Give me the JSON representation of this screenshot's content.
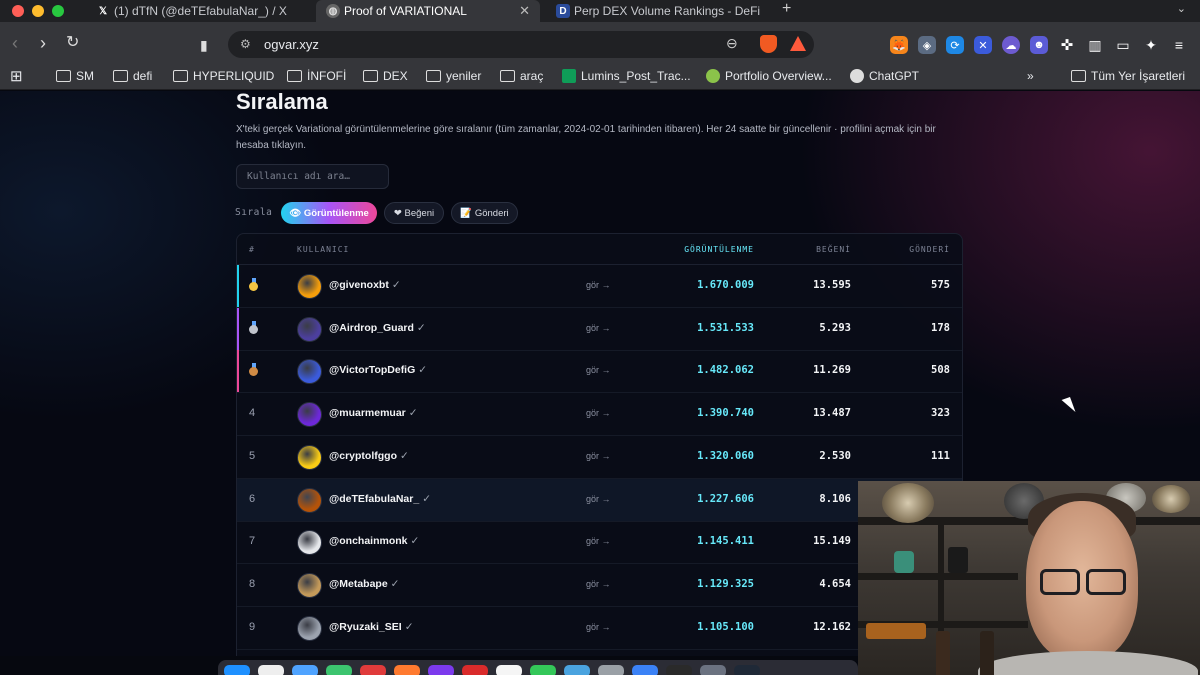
{
  "browser": {
    "tabs": [
      {
        "title": "(1) dTfN (@deTEfabulaNar_) / X",
        "icon": "x-logo-icon",
        "active": false
      },
      {
        "title": "Proof of VARIATIONAL",
        "icon": "globe-icon",
        "active": true
      },
      {
        "title": "Perp DEX Volume Rankings - DeFi",
        "icon": "defillama-icon",
        "active": false
      }
    ],
    "url": "ogvar.xyz",
    "bookmarks": [
      {
        "label": "SM",
        "icon": "folder-icon"
      },
      {
        "label": "defi",
        "icon": "folder-icon"
      },
      {
        "label": "HYPERLIQUID",
        "icon": "folder-icon"
      },
      {
        "label": "İNFOFİ",
        "icon": "folder-icon"
      },
      {
        "label": "DEX",
        "icon": "folder-icon"
      },
      {
        "label": "yeniler",
        "icon": "folder-icon"
      },
      {
        "label": "araç",
        "icon": "folder-icon"
      },
      {
        "label": "Lumins_Post_Trac...",
        "icon": "sheets-icon"
      },
      {
        "label": "Portfolio Overview...",
        "icon": "portfolio-icon"
      },
      {
        "label": "ChatGPT",
        "icon": "chatgpt-icon"
      }
    ],
    "all_bookmarks": "Tüm Yer İşaretleri"
  },
  "page": {
    "title": "Sıralama",
    "description": "X'teki gerçek Variational görüntülenmelerine göre sıralanır (tüm zamanlar, 2024-02-01 tarihinden itibaren). Her 24 saatte bir güncellenir · profilini açmak için bir hesaba tıklayın.",
    "search_placeholder": "Kullanıcı adı ara…",
    "sort_label": "Sırala",
    "sort_chips": [
      {
        "label": "👁 Görüntülenme",
        "active": true
      },
      {
        "label": "❤ Beğeni",
        "active": false
      },
      {
        "label": "📝 Gönderi",
        "active": false
      }
    ],
    "columns": {
      "rank": "#",
      "user": "KULLANICI",
      "views": "GÖRÜNTÜLENME",
      "likes": "BEĞENİ",
      "posts": "GÖNDERİ"
    },
    "view_link": "gör →",
    "rows": [
      {
        "rank": "1",
        "medal": "gold",
        "user": "@givenoxbt",
        "views": "1.670.009",
        "likes": "13.595",
        "posts": "575"
      },
      {
        "rank": "2",
        "medal": "silver",
        "user": "@Airdrop_Guard",
        "views": "1.531.533",
        "likes": "5.293",
        "posts": "178"
      },
      {
        "rank": "3",
        "medal": "bronze",
        "user": "@VictorTopDefiG",
        "views": "1.482.062",
        "likes": "11.269",
        "posts": "508"
      },
      {
        "rank": "4",
        "medal": "",
        "user": "@muarmemuar",
        "views": "1.390.740",
        "likes": "13.487",
        "posts": "323"
      },
      {
        "rank": "5",
        "medal": "",
        "user": "@cryptolfggo",
        "views": "1.320.060",
        "likes": "2.530",
        "posts": "111"
      },
      {
        "rank": "6",
        "medal": "",
        "user": "@deTEfabulaNar_",
        "views": "1.227.606",
        "likes": "8.106",
        "posts": ""
      },
      {
        "rank": "7",
        "medal": "",
        "user": "@onchainmonk",
        "views": "1.145.411",
        "likes": "15.149",
        "posts": ""
      },
      {
        "rank": "8",
        "medal": "",
        "user": "@Metabape",
        "views": "1.129.325",
        "likes": "4.654",
        "posts": ""
      },
      {
        "rank": "9",
        "medal": "",
        "user": "@Ryuzaki_SEI",
        "views": "1.105.100",
        "likes": "12.162",
        "posts": ""
      }
    ]
  },
  "colors": {
    "accent_cyan": "#67e8f9",
    "gold": "#f5c542",
    "silver": "#c0c4cc",
    "bronze": "#d08b45",
    "gradient_chip": [
      "#22d3ee",
      "#a855f7",
      "#ec4899"
    ]
  }
}
